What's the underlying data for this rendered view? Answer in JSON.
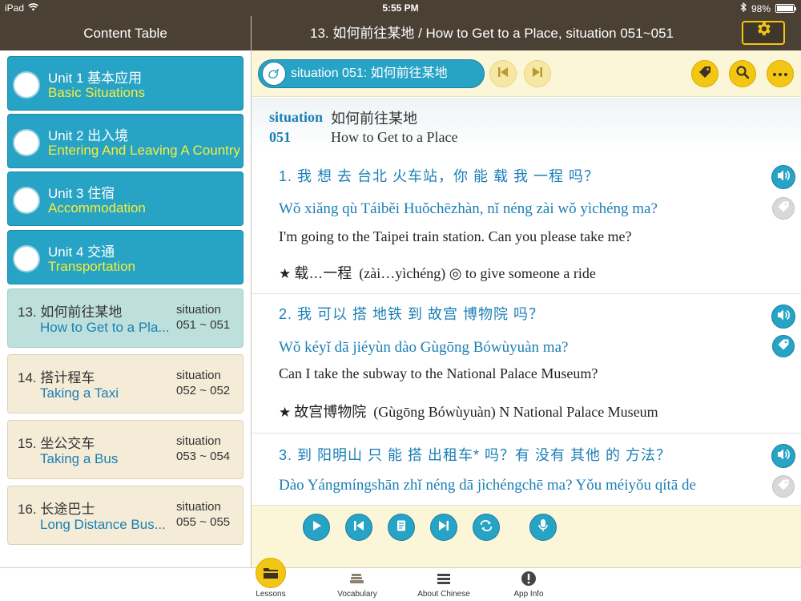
{
  "status_bar": {
    "device": "iPad",
    "time": "5:55 PM",
    "battery": "98%",
    "battery_level": 0.98
  },
  "sidebar": {
    "title": "Content Table",
    "units": [
      {
        "zh": "Unit 1 基本应用",
        "en": "Basic Situations"
      },
      {
        "zh": "Unit 2 出入境",
        "en": "Entering And Leaving A Country"
      },
      {
        "zh": "Unit 3 住宿",
        "en": "Accommodation"
      },
      {
        "zh": "Unit 4 交通",
        "en": "Transportation"
      }
    ],
    "lessons": [
      {
        "zh": "13. 如何前往某地",
        "en": "How to Get to a Pla...",
        "situation": "situation",
        "range": "051 ~ 051",
        "active": true
      },
      {
        "zh": "14. 搭计程车",
        "en": "Taking a Taxi",
        "situation": "situation",
        "range": "052 ~ 052",
        "active": false
      },
      {
        "zh": "15. 坐公交车",
        "en": "Taking a Bus",
        "situation": "situation",
        "range": "053 ~ 054",
        "active": false
      },
      {
        "zh": "16. 长途巴士",
        "en": "Long Distance Bus...",
        "situation": "situation",
        "range": "055 ~ 055",
        "active": false
      }
    ]
  },
  "header": {
    "title": "13. 如何前往某地 / How to Get to a Place, situation 051~051",
    "settings_icon": "gear-icon"
  },
  "toolbar": {
    "situation_label": "situation 051: 如何前往某地"
  },
  "situation": {
    "label": "situation",
    "number": "051",
    "zh": "如何前往某地",
    "en": "How to Get to a Place"
  },
  "sentences": [
    {
      "zh": "1. 我 想 去 台北 火车站，你 能 载 我 一程 吗？",
      "pinyin": "Wǒ xiǎng qù Táiběi Huǒchēzhàn, nǐ néng zài wǒ yìchéng ma?",
      "en": "I'm going to the Taipei train station. Can you please take me?",
      "note_zh": "载…一程",
      "note_rest": "(zài…yìchéng)  ◎  to give someone a ride",
      "tagged": false
    },
    {
      "zh": "2. 我 可以 搭 地铁 到 故宫 博物院 吗？",
      "pinyin": "Wǒ kéyǐ dā jiéyùn dào Gùgōng Bówùyuàn ma?",
      "en": "Can I take the subway to the National Palace Museum?",
      "note_zh": "故宫博物院",
      "note_rest": "(Gùgōng Bówùyuàn)  N  National Palace Museum",
      "tagged": true
    },
    {
      "zh": "3. 到 阳明山 只 能 搭 出租车* 吗？有 没有 其他 的 方法？",
      "pinyin": "Dào Yángmíngshān zhǐ néng dā jìchéngchē ma? Yǒu méiyǒu qítā de",
      "tagged": false
    }
  ],
  "tabs": [
    {
      "label": "Lessons",
      "icon": "lessons-icon"
    },
    {
      "label": "Vocabulary",
      "icon": "vocabulary-icon"
    },
    {
      "label": "About Chinese",
      "icon": "about-chinese-icon"
    },
    {
      "label": "App Info",
      "icon": "app-info-icon"
    }
  ],
  "colors": {
    "header_bg": "#4a4033",
    "accent_blue": "#27a3c5",
    "accent_yellow": "#f3c613",
    "cream": "#fcf6d8",
    "active_lesson": "#bee0dc",
    "lesson_bg": "#f4ecd7"
  }
}
